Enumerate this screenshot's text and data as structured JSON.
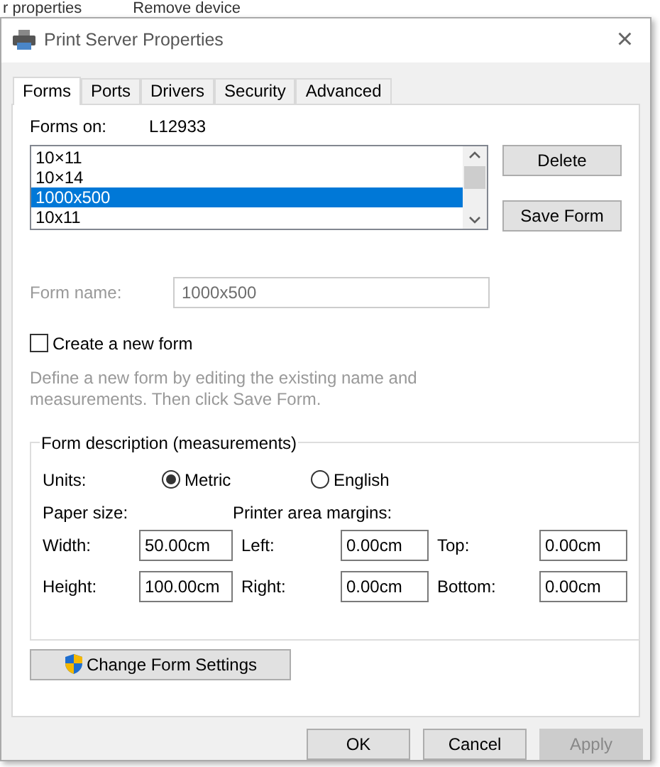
{
  "background": {
    "items": [
      "r properties",
      "Remove device"
    ]
  },
  "window": {
    "title": "Print Server Properties",
    "close": "×"
  },
  "tabs": [
    {
      "label": "Forms",
      "selected": true
    },
    {
      "label": "Ports",
      "selected": false
    },
    {
      "label": "Drivers",
      "selected": false
    },
    {
      "label": "Security",
      "selected": false
    },
    {
      "label": "Advanced",
      "selected": false
    }
  ],
  "forms_on": {
    "label": "Forms on:",
    "value": "L12933"
  },
  "forms_list": [
    {
      "label": "10×11",
      "selected": false
    },
    {
      "label": "10×14",
      "selected": false
    },
    {
      "label": "1000x500",
      "selected": true
    },
    {
      "label": "10x11",
      "selected": false
    }
  ],
  "side_buttons": [
    "Delete",
    "Save Form"
  ],
  "form_name": {
    "label": "Form name:",
    "value": "1000x500",
    "disabled": true
  },
  "create_new": {
    "label": "Create a new form",
    "checked": false
  },
  "hint": "Define a new form by editing the existing name and measurements. Then click Save Form.",
  "group": {
    "title": "Form description (measurements)",
    "units_label": "Units:",
    "units": [
      {
        "label": "Metric",
        "selected": true
      },
      {
        "label": "English",
        "selected": false
      }
    ],
    "paper_size": "Paper size:",
    "margins_label": "Printer area margins:",
    "rows": [
      [
        {
          "label": "Width:",
          "value": "50.00cm"
        },
        {
          "label": "Left:",
          "value": "0.00cm"
        },
        {
          "label": "Top:",
          "value": "0.00cm"
        }
      ],
      [
        {
          "label": "Height:",
          "value": "100.00cm"
        },
        {
          "label": "Right:",
          "value": "0.00cm"
        },
        {
          "label": "Bottom:",
          "value": "0.00cm"
        }
      ]
    ]
  },
  "change_button": "Change Form Settings",
  "footer_buttons": [
    {
      "label": "OK",
      "disabled": false
    },
    {
      "label": "Cancel",
      "disabled": false
    },
    {
      "label": "Apply",
      "disabled": true
    }
  ]
}
